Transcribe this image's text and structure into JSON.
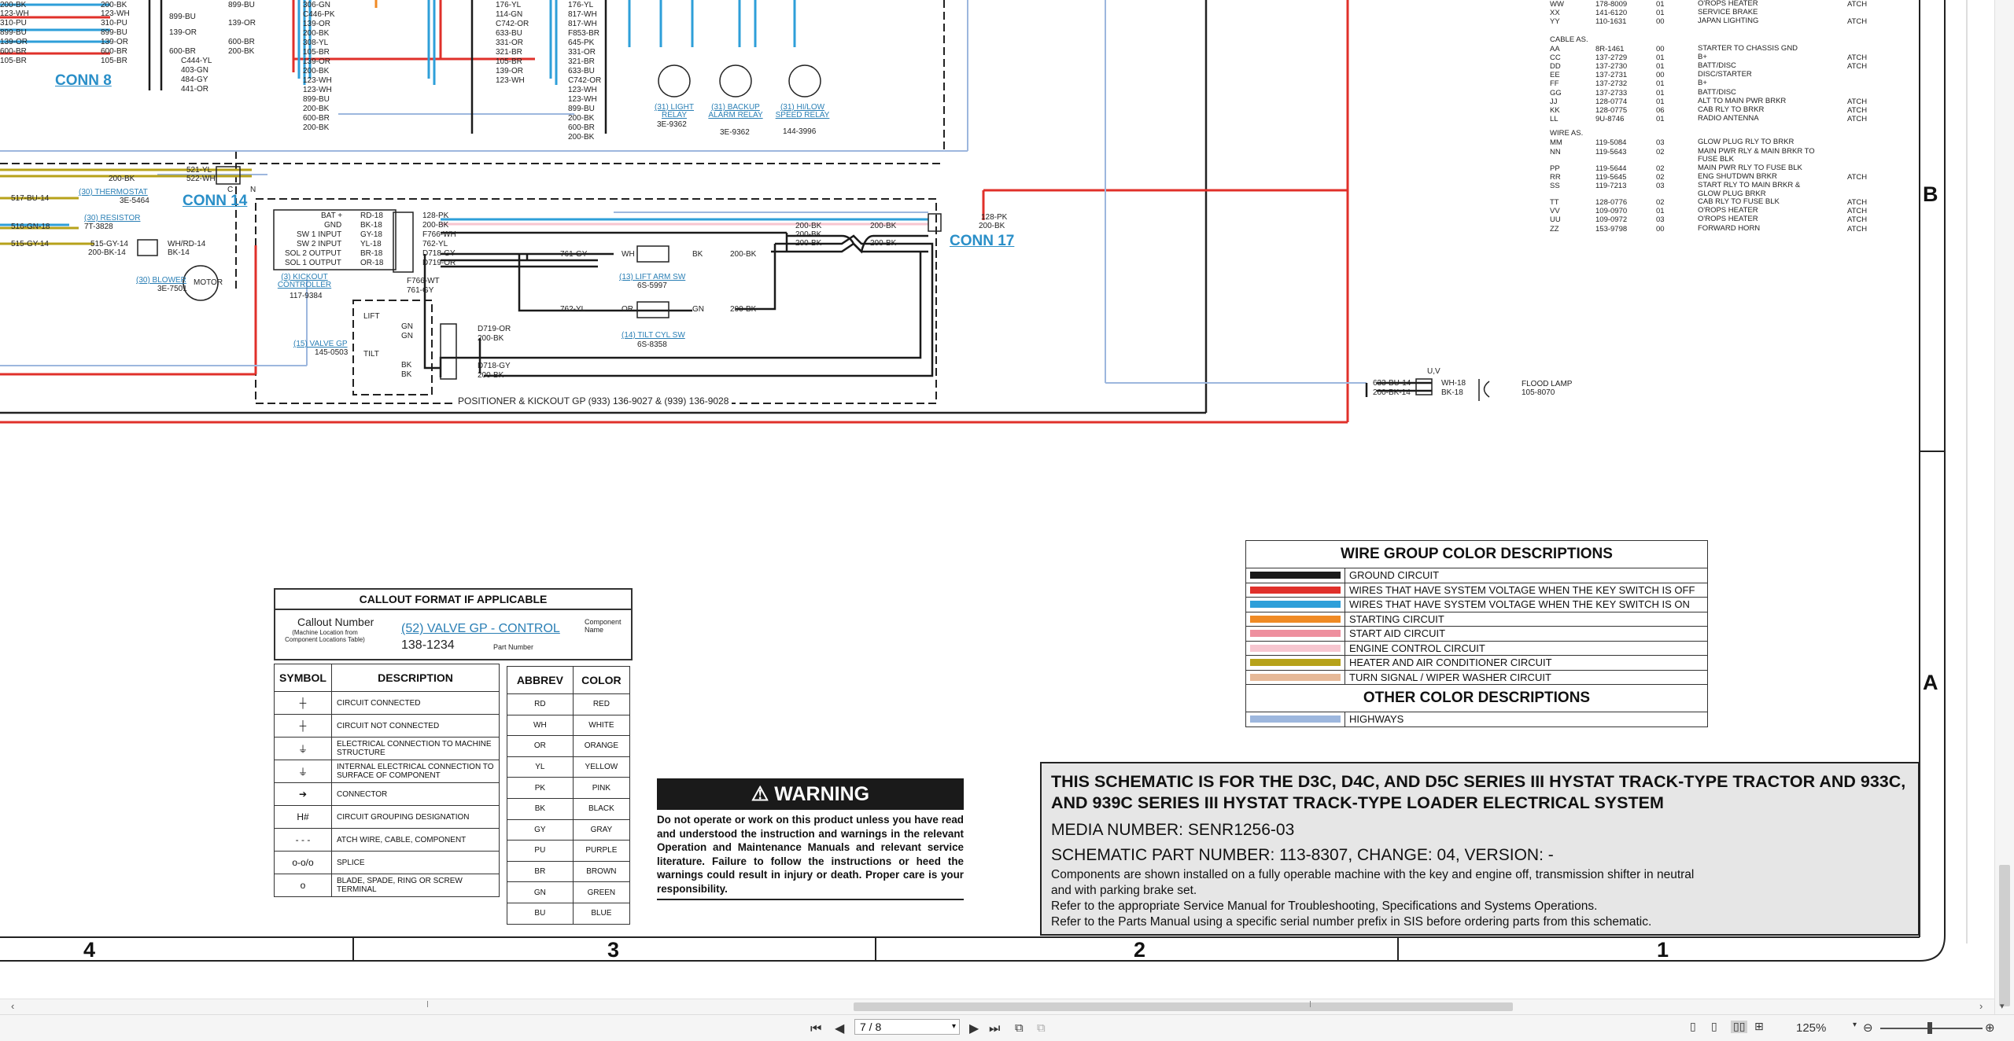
{
  "connectors": {
    "conn8": "CONN 8",
    "conn14": "CONN 14",
    "conn17": "CONN 17"
  },
  "wire_labels_left": [
    "200-BK",
    "123-WH",
    "310-PU",
    "899-BU",
    "139-OR",
    "600-BR",
    "105-BR"
  ],
  "wire_labels_left2": [
    "200-BK",
    "123-WH",
    "310-PU",
    "899-BU",
    "139-OR",
    "600-BR",
    "105-BR"
  ],
  "wire_labels_col3": [
    "899-BU",
    "139-OR",
    "899-BU",
    "139-OR",
    "600-BR",
    "200-BK",
    "C444-YL",
    "403-GN",
    "484-GY",
    "441-OR"
  ],
  "wire_labels_col3b": [
    "899-BU",
    "139-OR",
    "600-BR",
    "200-BK"
  ],
  "wire_labels_col4": [
    "306-GN",
    "C446-PK",
    "139-OR",
    "200-BK",
    "308-YL",
    "105-BR",
    "139-OR",
    "200-BK",
    "123-WH",
    "123-WH",
    "899-BU",
    "200-BK",
    "600-BR",
    "200-BK"
  ],
  "wire_labels_col5": [
    "176-YL",
    "114-GN",
    "C742-OR",
    "633-BU",
    "331-OR",
    "321-BR",
    "105-BR",
    "139-OR",
    "123-WH"
  ],
  "wire_labels_col6": [
    "176-YL",
    "817-WH",
    "817-WH",
    "F853-BR",
    "645-PK",
    "331-OR",
    "321-BR",
    "633-BU",
    "C742-OR",
    "123-WH",
    "123-WH",
    "899-BU",
    "200-BK",
    "600-BR",
    "200-BK"
  ],
  "relays": {
    "light": {
      "name": "(31) LIGHT RELAY",
      "part": "3E-9362"
    },
    "backup": {
      "name": "(31) BACKUP ALARM RELAY",
      "part": "3E-9362"
    },
    "hilow": {
      "name": "(31) HI/LOW SPEED RELAY",
      "part": "144-3996"
    }
  },
  "relay_wires": [
    "645-PK",
    "200-BK",
    "633-BU",
    "817-WH",
    "123-WH",
    "331-OR",
    "321-BR",
    "200-BK",
    "C742-OR",
    "F853-BR",
    "899-BU"
  ],
  "conn14_area": {
    "wires": [
      "521-YL",
      "522-WH",
      "200-BK"
    ],
    "left_wires": [
      "517-BU-14",
      "516-GN-18",
      "515-GY-14"
    ],
    "thermostat": {
      "name": "(30) THERMOSTAT",
      "part": "3E-5464"
    },
    "resistor": {
      "name": "(30) RESISTOR",
      "part": "7T-3828"
    },
    "blower": {
      "name": "(30) BLOWER",
      "part": "3E-7501"
    },
    "motor": "MOTOR",
    "blower_wires": [
      "515-GY-14",
      "200-BK-14",
      "WH/RD-14",
      "BK-14"
    ],
    "letters": [
      "C",
      "N",
      "K",
      "K",
      "K",
      "K",
      "C"
    ]
  },
  "kickout": {
    "pins": [
      "BAT +",
      "GND",
      "SW 1 INPUT",
      "SW 2 INPUT",
      "SOL 2 OUTPUT",
      "SOL 1 OUTPUT"
    ],
    "wires_left": [
      "RD-18",
      "BK-18",
      "GY-18",
      "YL-18",
      "BR-18",
      "OR-18"
    ],
    "wires_right": [
      "128-PK",
      "200-BK",
      "F766-WH",
      "762-YL",
      "D718-GY",
      "D719-OR"
    ],
    "name": "(3) KICKOUT CONTROLLER",
    "part": "117-9384",
    "lower_wires": [
      "F766-WT",
      "761-GY"
    ]
  },
  "switches": {
    "lift": {
      "name": "(13) LIFT ARM SW",
      "part": "6S-5997",
      "wires": [
        "761-GY",
        "WH",
        "BK",
        "200-BK"
      ]
    },
    "tilt": {
      "name": "(14) TILT CYL SW",
      "part": "6S-8358",
      "wires": [
        "762-YL",
        "OR",
        "GN",
        "200-BK"
      ]
    }
  },
  "valve": {
    "name": "(15) VALVE GP",
    "part": "145-0503",
    "labels": [
      "LIFT",
      "TILT",
      "GN",
      "GN",
      "BK",
      "BK",
      "D719-OR",
      "200-BK",
      "D718-GY",
      "200-BK"
    ]
  },
  "conn17_wires": [
    "128-PK",
    "200-BK",
    "200-BK",
    "200-BK",
    "200-BK",
    "200-BK",
    "200-BK"
  ],
  "positioner": "POSITIONER & KICKOUT GP (933) 136-9027 & (939) 136-9028",
  "flood": {
    "name": "FLOOD LAMP",
    "part": "105-8070",
    "wires": [
      "633-BU-14",
      "200-BK-14",
      "WH-18",
      "BK-18"
    ],
    "letters": "U,V"
  },
  "harness_list": {
    "top": [
      {
        "code": "WW",
        "part": "178-8009",
        "qty": "01",
        "desc": "O'ROPS HEATER",
        "atch": "ATCH"
      },
      {
        "code": "XX",
        "part": "141-6120",
        "qty": "01",
        "desc": "SERVICE BRAKE",
        "atch": ""
      },
      {
        "code": "YY",
        "part": "110-1631",
        "qty": "00",
        "desc": "JAPAN LIGHTING",
        "atch": "ATCH"
      }
    ],
    "cable_title": "CABLE AS.",
    "cable": [
      {
        "code": "AA",
        "part": "8R-1461",
        "qty": "00",
        "desc": "STARTER TO CHASSIS GND",
        "atch": ""
      },
      {
        "code": "CC",
        "part": "137-2729",
        "qty": "01",
        "desc": "B+",
        "atch": "ATCH"
      },
      {
        "code": "DD",
        "part": "137-2730",
        "qty": "01",
        "desc": "BATT/DISC",
        "atch": "ATCH"
      },
      {
        "code": "EE",
        "part": "137-2731",
        "qty": "00",
        "desc": "DISC/STARTER",
        "atch": ""
      },
      {
        "code": "FF",
        "part": "137-2732",
        "qty": "01",
        "desc": "B+",
        "atch": ""
      },
      {
        "code": "GG",
        "part": "137-2733",
        "qty": "01",
        "desc": "BATT/DISC",
        "atch": ""
      },
      {
        "code": "JJ",
        "part": "128-0774",
        "qty": "01",
        "desc": "ALT TO MAIN PWR BRKR",
        "atch": "ATCH"
      },
      {
        "code": "KK",
        "part": "128-0775",
        "qty": "06",
        "desc": "CAB RLY TO BRKR",
        "atch": "ATCH"
      },
      {
        "code": "LL",
        "part": "9U-8746",
        "qty": "01",
        "desc": "RADIO ANTENNA",
        "atch": "ATCH"
      }
    ],
    "wire_title": "WIRE AS.",
    "wire": [
      {
        "code": "MM",
        "part": "119-5084",
        "qty": "03",
        "desc": "GLOW PLUG RLY TO BRKR",
        "atch": ""
      },
      {
        "code": "NN",
        "part": "119-5643",
        "qty": "02",
        "desc": "MAIN PWR RLY & MAIN BRKR TO FUSE BLK",
        "atch": ""
      },
      {
        "code": "PP",
        "part": "119-5644",
        "qty": "02",
        "desc": "MAIN PWR RLY TO FUSE BLK",
        "atch": ""
      },
      {
        "code": "RR",
        "part": "119-5645",
        "qty": "02",
        "desc": "ENG SHUTDWN BRKR",
        "atch": "ATCH"
      },
      {
        "code": "SS",
        "part": "119-7213",
        "qty": "03",
        "desc": "START RLY TO MAIN BRKR & GLOW PLUG BRKR",
        "atch": ""
      },
      {
        "code": "TT",
        "part": "128-0776",
        "qty": "02",
        "desc": "CAB RLY TO FUSE BLK",
        "atch": "ATCH"
      },
      {
        "code": "VV",
        "part": "109-0970",
        "qty": "01",
        "desc": "O'ROPS HEATER",
        "atch": "ATCH"
      },
      {
        "code": "UU",
        "part": "109-0972",
        "qty": "03",
        "desc": "O'ROPS HEATER",
        "atch": "ATCH"
      },
      {
        "code": "ZZ",
        "part": "153-9798",
        "qty": "00",
        "desc": "FORWARD HORN",
        "atch": "ATCH"
      }
    ]
  },
  "wire_colors": {
    "title": "WIRE GROUP COLOR DESCRIPTIONS",
    "rows": [
      {
        "color": "#1a1a1a",
        "label": "GROUND CIRCUIT"
      },
      {
        "color": "#e0302a",
        "label": "WIRES THAT HAVE SYSTEM VOLTAGE WHEN THE KEY SWITCH IS OFF"
      },
      {
        "color": "#2e9fd9",
        "label": "WIRES THAT HAVE SYSTEM VOLTAGE WHEN THE KEY SWITCH IS ON"
      },
      {
        "color": "#f08a24",
        "label": "STARTING CIRCUIT"
      },
      {
        "color": "#ee8f9e",
        "label": "START AID CIRCUIT"
      },
      {
        "color": "#f7c6d0",
        "label": "ENGINE CONTROL CIRCUIT"
      },
      {
        "color": "#b7a21a",
        "label": "HEATER AND AIR CONDITIONER CIRCUIT"
      },
      {
        "color": "#e6b998",
        "label": "TURN SIGNAL / WIPER WASHER CIRCUIT"
      }
    ],
    "other_title": "OTHER COLOR DESCRIPTIONS",
    "other_rows": [
      {
        "color": "#9db7de",
        "label": "HIGHWAYS"
      }
    ]
  },
  "callout": {
    "title": "CALLOUT FORMAT IF APPLICABLE",
    "callout_number": "Callout Number",
    "callout_sub": "(Machine Location from Component Locations Table)",
    "example": "(52) VALVE GP - CONTROL",
    "component_name": "Component Name",
    "part": "138-1234",
    "part_label": "Part Number"
  },
  "symbols": {
    "col1": "SYMBOL",
    "col2": "DESCRIPTION",
    "rows": [
      {
        "sym": "┼",
        "desc": "CIRCUIT CONNECTED"
      },
      {
        "sym": "┼",
        "desc": "CIRCUIT NOT CONNECTED"
      },
      {
        "sym": "⏚",
        "desc": "ELECTRICAL CONNECTION TO MACHINE STRUCTURE"
      },
      {
        "sym": "⏚",
        "desc": "INTERNAL ELECTRICAL CONNECTION TO SURFACE OF COMPONENT"
      },
      {
        "sym": "➔",
        "desc": "CONNECTOR"
      },
      {
        "sym": "H#",
        "desc": "CIRCUIT GROUPING DESIGNATION"
      },
      {
        "sym": "- - -",
        "desc": "ATCH WIRE, CABLE, COMPONENT"
      },
      {
        "sym": "o-o/o",
        "desc": "SPLICE"
      },
      {
        "sym": "o",
        "desc": "BLADE, SPADE, RING OR SCREW TERMINAL"
      }
    ]
  },
  "abbrev": {
    "col1": "ABBREV",
    "col2": "COLOR",
    "rows": [
      [
        "RD",
        "RED"
      ],
      [
        "WH",
        "WHITE"
      ],
      [
        "OR",
        "ORANGE"
      ],
      [
        "YL",
        "YELLOW"
      ],
      [
        "PK",
        "PINK"
      ],
      [
        "BK",
        "BLACK"
      ],
      [
        "GY",
        "GRAY"
      ],
      [
        "PU",
        "PURPLE"
      ],
      [
        "BR",
        "BROWN"
      ],
      [
        "GN",
        "GREEN"
      ],
      [
        "BU",
        "BLUE"
      ]
    ]
  },
  "warning": {
    "title": "WARNING",
    "text": "Do not operate or work on this product unless you have read and understood the instruction and warnings in the relevant Operation and Maintenance Manuals and relevant service literature. Failure to follow the instructions or heed the warnings could result in injury or death. Proper care is your responsibility."
  },
  "titleblock": {
    "heading": "THIS SCHEMATIC IS FOR THE D3C, D4C, AND D5C SERIES III HYSTAT TRACK-TYPE TRACTOR AND 933C, AND 939C SERIES III HYSTAT TRACK-TYPE LOADER ELECTRICAL SYSTEM",
    "media": "MEDIA NUMBER: SENR1256-03",
    "part": "SCHEMATIC PART NUMBER: 113-8307, CHANGE: 04, VERSION: -",
    "note1": "Components are shown installed on a fully operable machine with the key and engine off, transmission shifter in neutral and with parking brake set.",
    "note2": "Refer to the appropriate Service Manual for Troubleshooting, Specifications and Systems Operations.",
    "note3": "Refer to the Parts Manual using a specific serial number prefix in SIS before ordering parts from this schematic."
  },
  "grid": {
    "cols": [
      "4",
      "3",
      "2",
      "1"
    ],
    "rows": [
      "B",
      "A"
    ]
  },
  "viewer": {
    "page": "7 / 8",
    "zoom": "125%",
    "first_page_icon": "first-page-icon",
    "prev_page_icon": "prev-page-icon",
    "next_page_icon": "next-page-icon",
    "last_page_icon": "last-page-icon"
  }
}
